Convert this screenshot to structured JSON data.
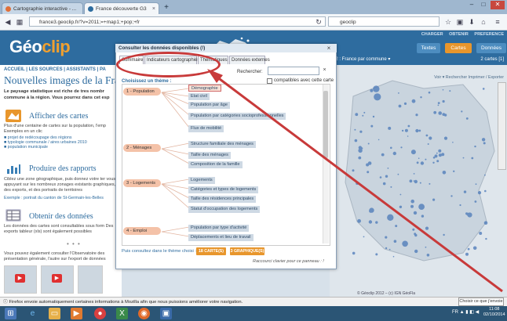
{
  "browser": {
    "tabs": [
      {
        "label": "Cartographie interactive - ..."
      },
      {
        "label": "France découverte G3"
      }
    ],
    "url": "france3.geoclip.fr/?v=2011;=+map1;+pop;+fr",
    "search_engine": "geoclip",
    "new_tab": "+",
    "win_min": "–",
    "win_max": "□",
    "win_close": "✕"
  },
  "header": {
    "logo_a": "Géo",
    "logo_b": "clip",
    "top_menu": "CHARGER  OBTENIR  PREFERENCE",
    "btn_textes": "Textes",
    "btn_cartes": "Cartes",
    "btn_donnees": "Données"
  },
  "left": {
    "nav": "ACCUEIL | LES SOURCES | ASSISTANTS | PA",
    "headline": "Nouvelles images de la Fran",
    "intro": "Le paysage statistique est riche de tres nombr commune à la région. Vous pourrez dans cet esp",
    "sec1_title": "Afficher des cartes",
    "sec1_text": "Plus d'une centaine de cartes sur la population, l'emp Exemples en un clic",
    "sec1_links": [
      "■ projet de redécoupage des régions",
      "■ typologie communale / aires urbaines 2010",
      "■ population municipale"
    ],
    "sec2_title": "Produire des rapports",
    "sec2_text": "Ciblez une zone géographique, puis donnez votre ter vous appuyant sur les nombreux zonages existants graphiques, des exports, et des portraits de territoires",
    "sec2_link": "Exemple : portrait du canton de St-Germain-les-Belles",
    "sec3_title": "Obtenir des données",
    "sec3_text": "Les données des cartes sont consultables sous form Des exports tableur (xls) sont également possibles",
    "sep": "• • •",
    "bottom_text": "Vous pouvez également consulter l'Observatoire des présentation générale, l'autre sur l'export de données"
  },
  "map": {
    "bar_title": "12 : France par commune ▾",
    "bar_right": "2 cartes [1]",
    "toolbar": "Voir ▾   Rechercher   Imprimer / Exporter",
    "copyright": "© Géoclip 2012 – (c) IGN GéoFla"
  },
  "modal": {
    "title": "Consulter les données disponibles (!)",
    "close": "×",
    "tabs": [
      "Sommaire",
      "Indicateurs cartographiés",
      "Thématiques",
      "Données externes"
    ],
    "search_label": "Rechercher:",
    "search_value": "",
    "search_clear": "×",
    "compat_label": "compatibles avec cette carte",
    "choose_label": "Choisissez un thème :",
    "themes": [
      {
        "label": "1 - Population",
        "items": [
          "Démographie",
          "Etat civil",
          "Population par âge",
          "Population par catégories socioprofessionnelles",
          "Flux de mobilité"
        ]
      },
      {
        "label": "2 - Ménages",
        "items": [
          "Structure familiale des ménages",
          "Taille des ménages",
          "Composition de la famille"
        ]
      },
      {
        "label": "3 - Logements",
        "items": [
          "Logements",
          "Catégories et types de logements",
          "Taille des résidences principales",
          "Statut d'occupation des logements"
        ]
      },
      {
        "label": "4 - Emploi",
        "items": [
          "Population par type d'activité",
          "Déplacements et lieu de travail"
        ]
      }
    ],
    "footer_text": "Puis consultez dans le thème choisi :",
    "btn_cartes": "18 CARTE(S)",
    "btn_graphs": "3 GRAPHIQUE(S)",
    "shortcut": "Raccourci clavier pour ce panneau : !"
  },
  "notification": {
    "text": "Firefox envoie automatiquement certaines informations à Mozilla afin que nous puissions améliorer votre navigation.",
    "button": "Choisir ce que j'envoie"
  },
  "taskbar": {
    "tray": "FR ▲ ▮ ◧ ◀",
    "time": "11:08",
    "date": "02/10/2014"
  },
  "colors": {
    "header_blue": "#2e6c9f",
    "theme_salmon": "#f4c2a8",
    "annotation_red": "#c83a3a",
    "button_orange": "#e8962c"
  }
}
